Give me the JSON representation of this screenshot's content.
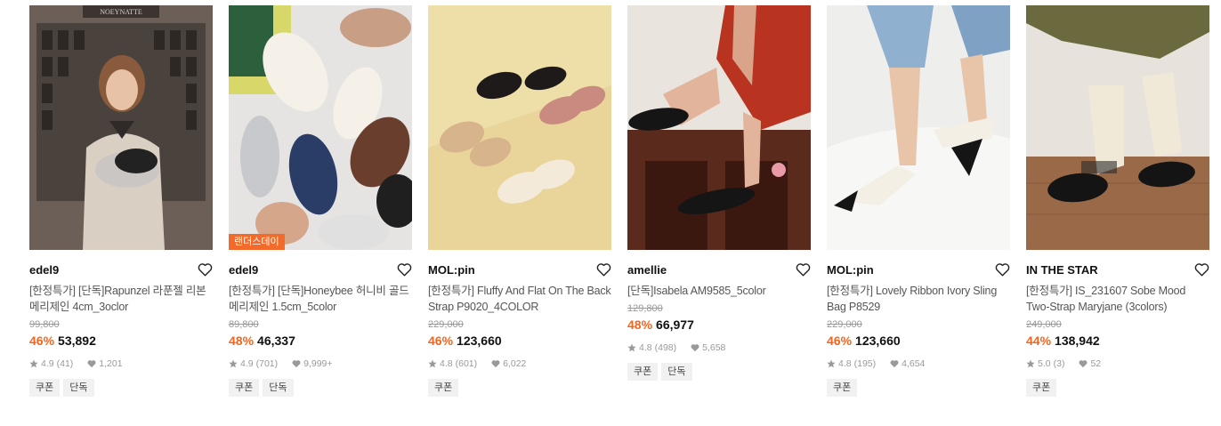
{
  "products": [
    {
      "brand": "edel9",
      "title": "[한정특가] [단독]Rapunzel 라푼젤 리본 메리제인 4cm_3oclor",
      "original_price": "99,800",
      "discount": "46%",
      "price": "53,892",
      "rating": "4.9",
      "reviews": "(41)",
      "likes": "1,201",
      "tags": [
        "쿠폰",
        "단독"
      ],
      "badge": "",
      "image_sign": "NOEYNATTE"
    },
    {
      "brand": "edel9",
      "title": "[한정특가] [단독]Honeybee 허니비 골드 메리제인 1.5cm_5color",
      "original_price": "89,800",
      "discount": "48%",
      "price": "46,337",
      "rating": "4.9",
      "reviews": "(701)",
      "likes": "9,999+",
      "tags": [
        "쿠폰",
        "단독"
      ],
      "badge": "랜더스데이"
    },
    {
      "brand": "MOL:pin",
      "title": "[한정특가] Fluffy And Flat On The Back Strap P9020_4COLOR",
      "original_price": "229,000",
      "discount": "46%",
      "price": "123,660",
      "rating": "4.8",
      "reviews": "(601)",
      "likes": "6,022",
      "tags": [
        "쿠폰"
      ],
      "badge": ""
    },
    {
      "brand": "amellie",
      "title": "[단독]Isabela AM9585_5color",
      "original_price": "129,800",
      "discount": "48%",
      "price": "66,977",
      "rating": "4.8",
      "reviews": "(498)",
      "likes": "5,658",
      "tags": [
        "쿠폰",
        "단독"
      ],
      "badge": ""
    },
    {
      "brand": "MOL:pin",
      "title": "[한정특가] Lovely Ribbon Ivory Sling Bag P8529",
      "original_price": "229,000",
      "discount": "46%",
      "price": "123,660",
      "rating": "4.8",
      "reviews": "(195)",
      "likes": "4,654",
      "tags": [
        "쿠폰"
      ],
      "badge": ""
    },
    {
      "brand": "IN THE STAR",
      "title": "[한정특가] IS_231607 Sobe Mood Two-Strap Maryjane (3colors)",
      "original_price": "249,000",
      "discount": "44%",
      "price": "138,942",
      "rating": "5.0",
      "reviews": "(3)",
      "likes": "52",
      "tags": [
        "쿠폰"
      ],
      "badge": ""
    }
  ],
  "colors": {
    "discount": "#f2651d",
    "badge_bg": "#f26b2a",
    "tag_bg": "#f1f1f1"
  }
}
